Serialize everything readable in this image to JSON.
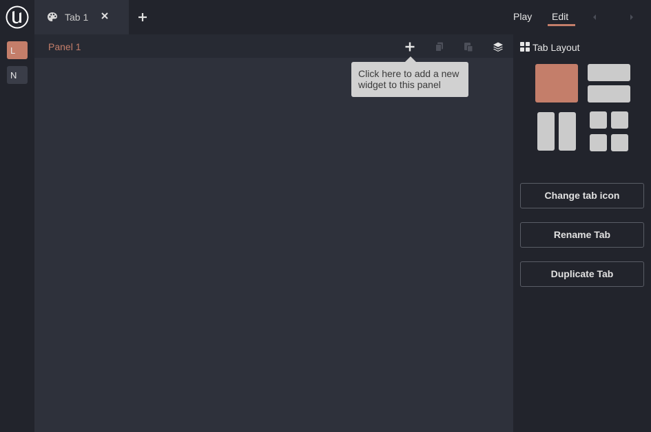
{
  "app": {
    "logo_icon": "unreal-engine-logo",
    "accent_color": "#c47e6a"
  },
  "tabs": [
    {
      "label": "Tab 1",
      "icon": "palette-icon"
    }
  ],
  "header": {
    "play_label": "Play",
    "edit_label": "Edit",
    "active_mode": "Edit"
  },
  "rail": {
    "items": [
      {
        "label": "L",
        "selected": true
      },
      {
        "label": "N",
        "selected": false
      }
    ]
  },
  "panel": {
    "title": "Panel 1",
    "tooltip": "Click here to add a new widget to this panel"
  },
  "sidebar": {
    "title": "Tab Layout",
    "layouts": [
      {
        "name": "single",
        "selected": true
      },
      {
        "name": "two-rows",
        "selected": false
      },
      {
        "name": "two-columns",
        "selected": false
      },
      {
        "name": "grid-2x2",
        "selected": false
      }
    ],
    "buttons": {
      "change_icon": "Change tab icon",
      "rename": "Rename Tab",
      "duplicate": "Duplicate Tab"
    }
  }
}
